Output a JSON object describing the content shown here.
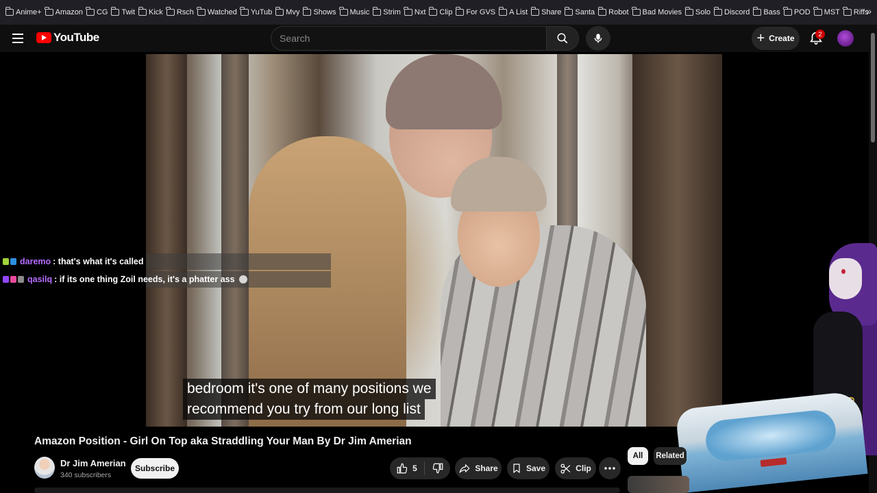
{
  "bookmarks": [
    "Anime+",
    "Amazon",
    "CG",
    "Twit",
    "Kick",
    "Rsch",
    "Watched",
    "YuTub",
    "Mvy",
    "Shows",
    "Music",
    "Strim",
    "Nxt",
    "Clip",
    "For GVS",
    "A List",
    "Share",
    "Santa",
    "Robot",
    "Bad Movies",
    "Solo",
    "Discord",
    "Bass",
    "POD",
    "MST",
    "Riffs"
  ],
  "header": {
    "logo_text": "YouTube",
    "search_placeholder": "Search",
    "create_label": "Create",
    "notification_count": "2"
  },
  "video": {
    "subtitle_lines": [
      "bedroom it's one of many positions we",
      "recommend you try from our long list"
    ]
  },
  "chat": [
    {
      "user": "daremo",
      "message": ": that's what it's called"
    },
    {
      "user": "qasilq",
      "message": ": if its one thing Zoil needs, it's a phatter ass"
    }
  ],
  "info": {
    "title": "Amazon Position - Girl On Top aka Straddling Your Man By Dr Jim Amerian",
    "channel_name": "Dr Jim Amerian",
    "subscriber_count": "340 subscribers",
    "subscribe_label": "Subscribe",
    "like_count": "5",
    "share_label": "Share",
    "save_label": "Save",
    "clip_label": "Clip"
  },
  "chips": [
    "All",
    "Related"
  ],
  "colors": {
    "accent_red": "#ff0000",
    "chat_username": "#b56bff",
    "background": "#0f0f0f"
  }
}
